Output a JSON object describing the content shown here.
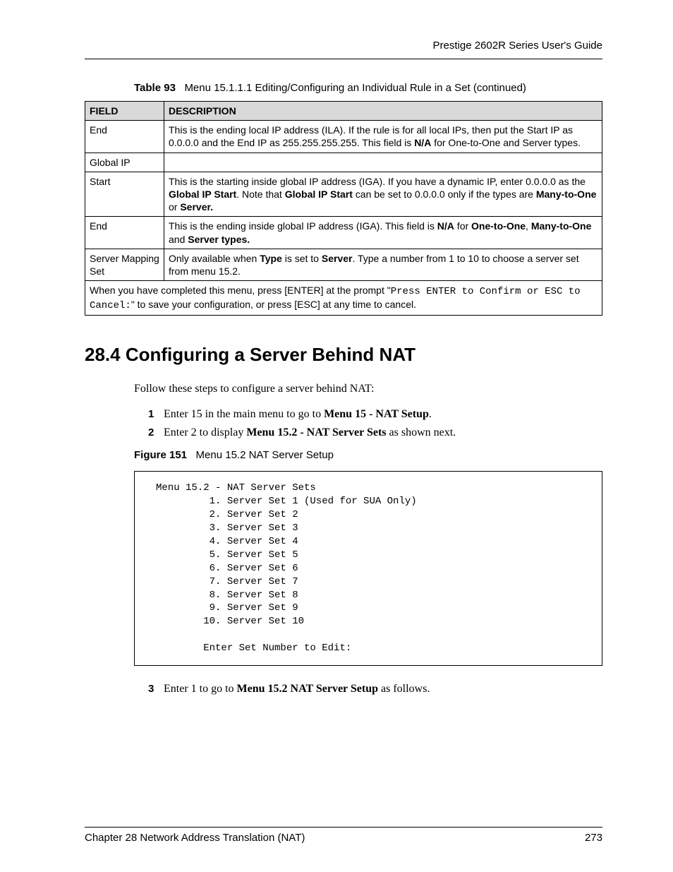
{
  "header": {
    "guide_title": "Prestige 2602R Series User's Guide"
  },
  "table_caption": {
    "label": "Table 93",
    "text": "Menu 15.1.1.1 Editing/Configuring an Individual Rule in a Set (continued)"
  },
  "table": {
    "headers": {
      "field": "FIELD",
      "description": "DESCRIPTION"
    },
    "rows": [
      {
        "field": "End",
        "desc_pre": "This is the ending local IP address (ILA). If the rule is for all local IPs, then put the Start IP as 0.0.0.0 and the End IP as 255.255.255.255. This field is ",
        "desc_b1": "N/A",
        "desc_post": " for One-to-One and Server types."
      },
      {
        "field": "Global IP",
        "desc_pre": "",
        "desc_b1": "",
        "desc_post": ""
      },
      {
        "field": "Start",
        "desc_pre": "This is the starting inside global IP address (IGA). If you have a dynamic IP, enter 0.0.0.0 as the ",
        "desc_b1": "Global IP Start",
        "desc_mid1": ". Note that ",
        "desc_b2": "Global IP Start",
        "desc_mid2": " can be set to 0.0.0.0 only if the types are ",
        "desc_b3": "Many-to-One",
        "desc_mid3": " or ",
        "desc_b4": "Server.",
        "desc_post": ""
      },
      {
        "field": "End",
        "desc_pre": "This is the ending inside global IP address (IGA). This field is ",
        "desc_b1": "N/A",
        "desc_mid1": " for ",
        "desc_b2": "One-to-One",
        "desc_mid2": ", ",
        "desc_b3": "Many-to-One",
        "desc_mid3": " and ",
        "desc_b4": "Server types.",
        "desc_post": ""
      },
      {
        "field": "Server Mapping Set",
        "desc_pre": "Only available when ",
        "desc_b1": "Type",
        "desc_mid1": " is set to ",
        "desc_b2": "Server",
        "desc_post": ". Type a number from 1 to 10 to choose a server set from menu 15.2."
      }
    ],
    "footer": {
      "pre": "When you have completed this menu, press [ENTER] at the prompt \"",
      "mono": "Press ENTER to Confirm or ESC to Cancel:",
      "post": "\" to save your configuration, or press [ESC] at any time to cancel."
    }
  },
  "section": {
    "heading": "28.4  Configuring a Server Behind NAT",
    "intro": "Follow these steps to configure a server behind NAT:",
    "steps": [
      {
        "num": "1",
        "pre": "Enter 15 in the main menu to go to ",
        "bold": "Menu 15 - NAT Setup",
        "post": "."
      },
      {
        "num": "2",
        "pre": "Enter 2 to display ",
        "bold": "Menu 15.2 - NAT Server Sets",
        "post": " as shown next."
      }
    ],
    "step3": {
      "num": "3",
      "pre": "Enter 1 to go to ",
      "bold": "Menu 15.2 NAT Server Setup",
      "post": " as follows."
    }
  },
  "figure": {
    "label": "Figure 151",
    "text": "Menu 15.2 NAT Server Setup"
  },
  "terminal": "Menu 15.2 - NAT Server Sets\n         1. Server Set 1 (Used for SUA Only)\n         2. Server Set 2\n         3. Server Set 3\n         4. Server Set 4\n         5. Server Set 5\n         6. Server Set 6\n         7. Server Set 7\n         8. Server Set 8\n         9. Server Set 9\n        10. Server Set 10\n\n        Enter Set Number to Edit:",
  "footer": {
    "left": "Chapter 28 Network Address Translation (NAT)",
    "right": "273"
  }
}
